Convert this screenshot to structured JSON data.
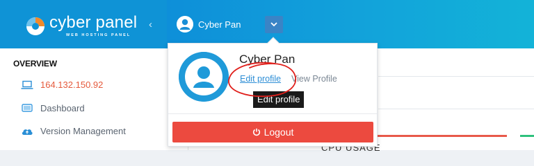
{
  "brand": {
    "title": "cyber panel",
    "subtitle": "WEB HOSTING PANEL",
    "collapse_icon": "chevron-left-icon",
    "color": "#0f93d6"
  },
  "header": {
    "user_name": "Cyber Pan",
    "avatar_icon": "user-icon",
    "dropdown_icon": "chevron-down-icon"
  },
  "sidebar": {
    "section_title": "OVERVIEW",
    "items": [
      {
        "label": "164.132.150.92",
        "icon": "laptop-icon",
        "color": "#e55a3c"
      },
      {
        "label": "Dashboard",
        "icon": "monitor-icon"
      },
      {
        "label": "Version Management",
        "icon": "cloud-upload-icon"
      }
    ]
  },
  "dropdown": {
    "name": "Cyber Pan",
    "edit_profile": "Edit profile",
    "view_profile": "View Profile",
    "tooltip": "Edit profile",
    "logout_label": "Logout",
    "logout_icon": "power-icon",
    "logout_color": "#ec4a3f"
  },
  "content": {
    "stat_label": "CPU USAGE"
  },
  "annotation": {
    "color": "#e0201c"
  }
}
